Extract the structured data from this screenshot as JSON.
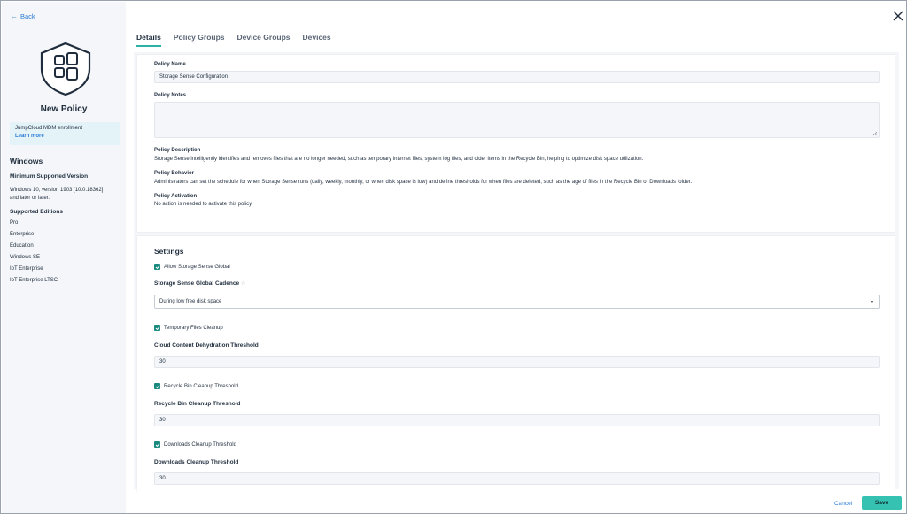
{
  "nav": {
    "back_label": "Back"
  },
  "sidebar": {
    "title": "New Policy",
    "mdm_text": "JumpCloud MDM enrollment",
    "mdm_link": "Learn more",
    "os": "Windows",
    "min_version_heading": "Minimum Supported Version",
    "min_version_line1": "Windows 10, version 1903 [10.0.18362]",
    "min_version_line2": "and later or later.",
    "editions_heading": "Supported Editions",
    "editions": [
      "Pro",
      "Enterprise",
      "Education",
      "Windows SE",
      "IoT Enterprise",
      "IoT Enterprise LTSC"
    ]
  },
  "tabs": [
    {
      "label": "Details"
    },
    {
      "label": "Policy Groups"
    },
    {
      "label": "Device Groups"
    },
    {
      "label": "Devices"
    }
  ],
  "details": {
    "policy_name_label": "Policy Name",
    "policy_name_value": "Storage Sense Configuration",
    "policy_notes_label": "Policy Notes",
    "policy_notes_value": "",
    "description_label": "Policy Description",
    "description_text": "Storage Sense intelligently identifies and removes files that are no longer needed, such as temporary internet files, system log files, and older items in the Recycle Bin, helping to optimize disk space utilization.",
    "behavior_label": "Policy Behavior",
    "behavior_text": "Administrators can set the schedule for when Storage Sense runs (daily, weekly, monthly, or when disk space is low) and define thresholds for when files are deleted, such as the age of files in the Recycle Bin or Downloads folder.",
    "activation_label": "Policy Activation",
    "activation_text": "No action is needed to activate this policy."
  },
  "settings": {
    "heading": "Settings",
    "allow_global_label": "Allow Storage Sense Global",
    "cadence_label": "Storage Sense Global Cadence",
    "cadence_value": "During low free disk space",
    "temp_cleanup_label": "Temporary Files Cleanup",
    "cloud_threshold_label": "Cloud Content Dehydration Threshold",
    "cloud_threshold_value": "30",
    "recycle_check_label": "Recycle Bin Cleanup Threshold",
    "recycle_threshold_label": "Recycle Bin Cleanup Threshold",
    "recycle_threshold_value": "30",
    "downloads_check_label": "Downloads Cleanup Threshold",
    "downloads_threshold_label": "Downloads Cleanup Threshold",
    "downloads_threshold_value": "30"
  },
  "footer": {
    "cancel_label": "Cancel",
    "save_label": "Save"
  },
  "colors": {
    "accent": "#35c2b2",
    "checkbox": "#1a8a7e",
    "link": "#2b7bd6"
  },
  "icons": {
    "back": "arrow-left-icon",
    "close": "close-icon",
    "shield": "shield-windows-icon",
    "check": "checkmark-icon",
    "star": "star-icon",
    "caret": "caret-down-icon"
  }
}
